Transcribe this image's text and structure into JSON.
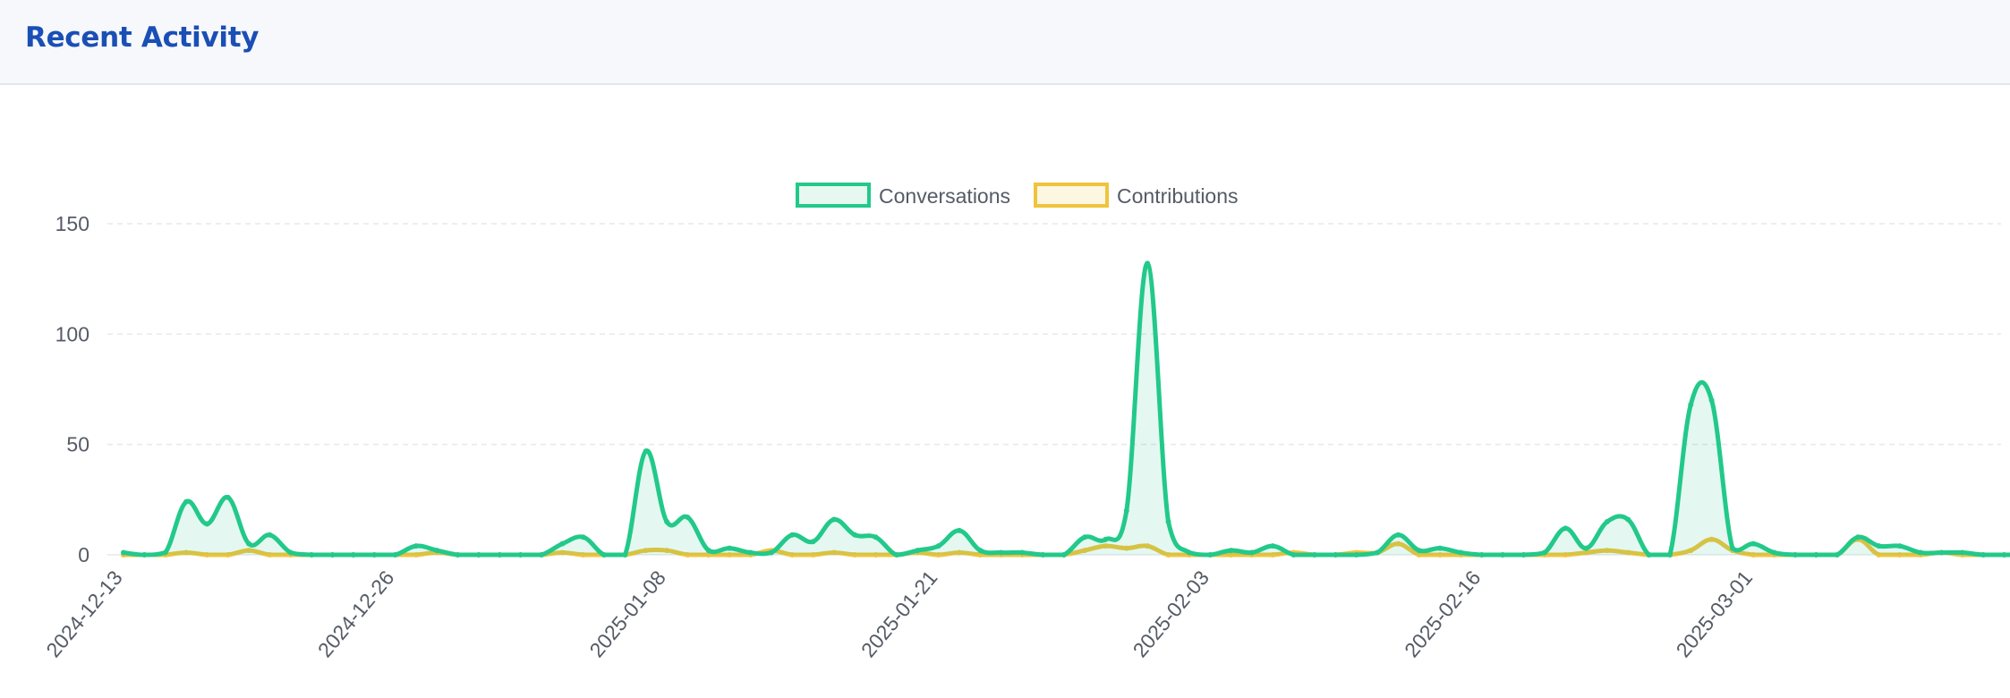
{
  "header": {
    "title": "Recent Activity"
  },
  "colors": {
    "conversations": "#22c98a",
    "contributions": "#f0c33c",
    "grid": "#e6e8ee",
    "text": "#555b66"
  },
  "chart_data": {
    "type": "line",
    "title": "",
    "xlabel": "",
    "ylabel": "",
    "ylim": [
      0,
      150
    ],
    "yticks": [
      0,
      50,
      100,
      150
    ],
    "grid": true,
    "legend": "top-center",
    "x_tick_labels": [
      "2024-12-13",
      "2024-12-26",
      "2025-01-08",
      "2025-01-21",
      "2025-02-03",
      "2025-02-16",
      "2025-03-01"
    ],
    "x": [
      "2024-12-13",
      "2024-12-14",
      "2024-12-15",
      "2024-12-16",
      "2024-12-17",
      "2024-12-18",
      "2024-12-19",
      "2024-12-20",
      "2024-12-21",
      "2024-12-22",
      "2024-12-23",
      "2024-12-24",
      "2024-12-25",
      "2024-12-26",
      "2024-12-27",
      "2024-12-28",
      "2024-12-29",
      "2024-12-30",
      "2024-12-31",
      "2025-01-01",
      "2025-01-02",
      "2025-01-03",
      "2025-01-04",
      "2025-01-05",
      "2025-01-06",
      "2025-01-07",
      "2025-01-08",
      "2025-01-09",
      "2025-01-10",
      "2025-01-11",
      "2025-01-12",
      "2025-01-13",
      "2025-01-14",
      "2025-01-15",
      "2025-01-16",
      "2025-01-17",
      "2025-01-18",
      "2025-01-19",
      "2025-01-20",
      "2025-01-21",
      "2025-01-22",
      "2025-01-23",
      "2025-01-24",
      "2025-01-25",
      "2025-01-26",
      "2025-01-27",
      "2025-01-28",
      "2025-01-29",
      "2025-01-30",
      "2025-01-31",
      "2025-02-01",
      "2025-02-02",
      "2025-02-03",
      "2025-02-04",
      "2025-02-05",
      "2025-02-06",
      "2025-02-07",
      "2025-02-08",
      "2025-02-09",
      "2025-02-10",
      "2025-02-11",
      "2025-02-12",
      "2025-02-13",
      "2025-02-14",
      "2025-02-15",
      "2025-02-16",
      "2025-02-17",
      "2025-02-18",
      "2025-02-19",
      "2025-02-20",
      "2025-02-21",
      "2025-02-22",
      "2025-02-23",
      "2025-02-24",
      "2025-02-25",
      "2025-02-26",
      "2025-02-27",
      "2025-02-28",
      "2025-03-01",
      "2025-03-02",
      "2025-03-03",
      "2025-03-04",
      "2025-03-05",
      "2025-03-06",
      "2025-03-07",
      "2025-03-08",
      "2025-03-09"
    ],
    "series": [
      {
        "name": "Conversations",
        "values": [
          1,
          0,
          1,
          24,
          14,
          26,
          5,
          9,
          1,
          0,
          0,
          0,
          0,
          0,
          4,
          2,
          0,
          0,
          0,
          0,
          0,
          5,
          8,
          0,
          0,
          47,
          15,
          17,
          2,
          3,
          1,
          1,
          9,
          6,
          16,
          9,
          8,
          0,
          2,
          4,
          11,
          2,
          1,
          1,
          0,
          0,
          8,
          7,
          20,
          132,
          15,
          1,
          0,
          2,
          1,
          4,
          0,
          0,
          0,
          0,
          1,
          9,
          2,
          3,
          1,
          0,
          0,
          0,
          1,
          12,
          3,
          15,
          16,
          0,
          0,
          68,
          70,
          3,
          5,
          1,
          0,
          0,
          0,
          8,
          4,
          4,
          1
        ],
        "values_tail": [
          1,
          1,
          0,
          0,
          0
        ]
      },
      {
        "name": "Contributions",
        "values": [
          0,
          0,
          0,
          1,
          0,
          0,
          2,
          0,
          0,
          0,
          0,
          0,
          0,
          0,
          0,
          1,
          0,
          0,
          0,
          0,
          0,
          1,
          0,
          0,
          0,
          2,
          2,
          0,
          0,
          0,
          0,
          2,
          0,
          0,
          1,
          0,
          0,
          0,
          1,
          0,
          1,
          0,
          0,
          0,
          0,
          0,
          2,
          4,
          3,
          4,
          0,
          0,
          0,
          0,
          0,
          0,
          1,
          0,
          0,
          1,
          1,
          5,
          0,
          0,
          0,
          0,
          0,
          0,
          0,
          0,
          1,
          2,
          1,
          0,
          0,
          2,
          7,
          2,
          0,
          0,
          0,
          0,
          0,
          7,
          0,
          0,
          0
        ],
        "values_tail": [
          1,
          0,
          0,
          0,
          0
        ]
      }
    ]
  }
}
